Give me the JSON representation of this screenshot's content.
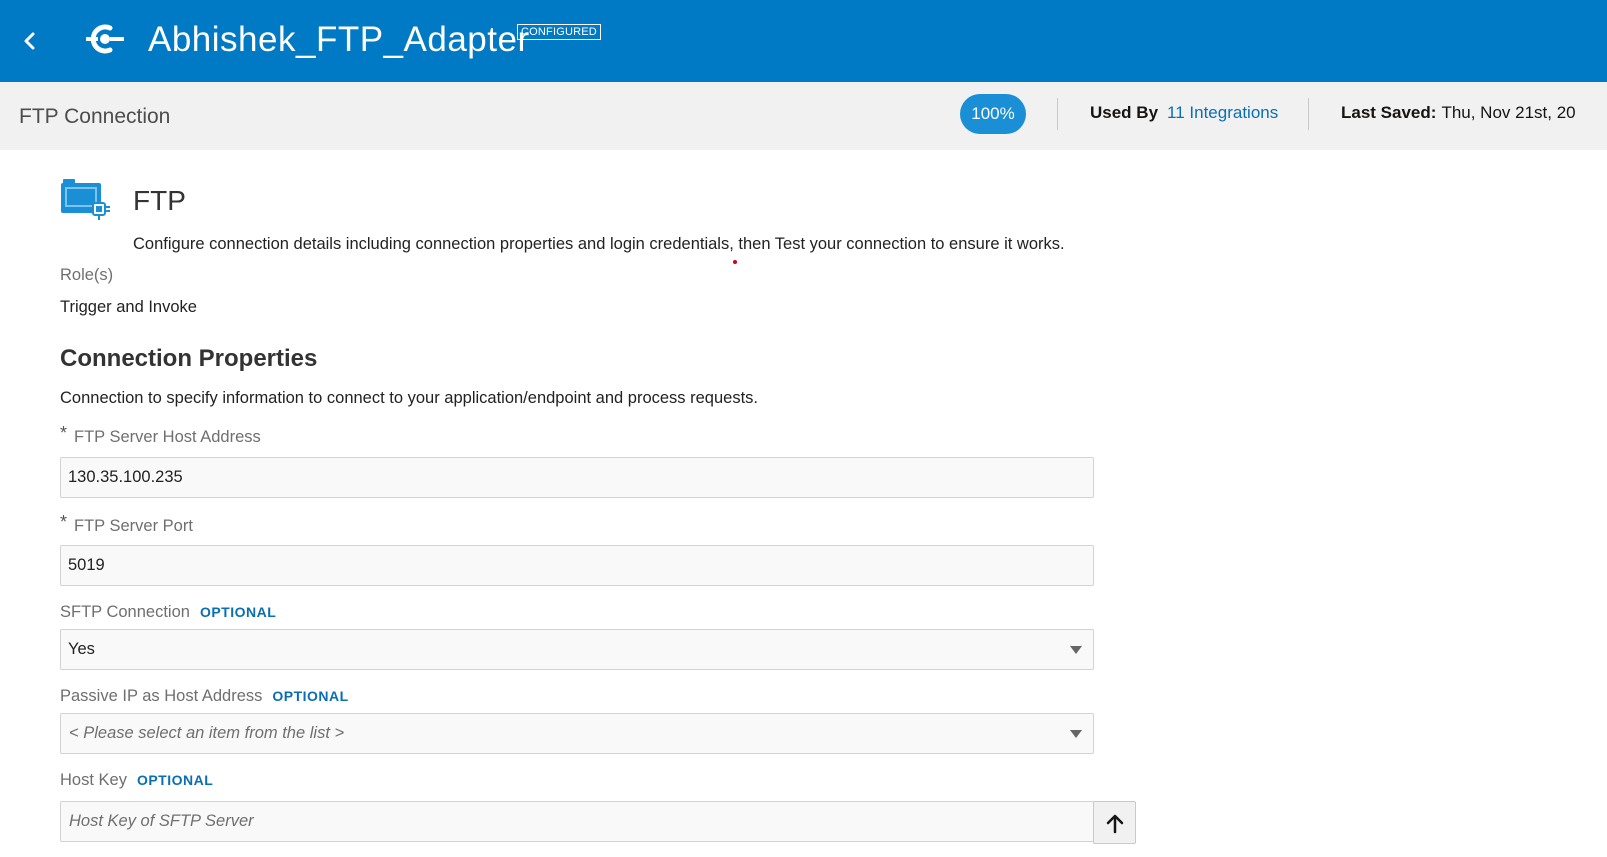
{
  "header": {
    "title": "Abhishek_FTP_Adapter",
    "status_badge": "CONFIGURED",
    "back_icon": "chevron-left-icon",
    "app_icon": "connection-plug-icon",
    "accent": "#007ac5"
  },
  "subheader": {
    "title": "FTP Connection",
    "progress_label": "100%",
    "progress_value": 1.0,
    "used_by_label": "Used By",
    "used_by_link": "11 Integrations",
    "last_saved_label": "Last Saved:",
    "last_saved_value": "Thu, Nov 21st, 20"
  },
  "adapter": {
    "icon": "ftp-adapter-icon",
    "name": "FTP",
    "description": "Configure connection details including connection properties and login credentials, then Test your connection to ensure it works.",
    "roles_label": "Role(s)",
    "roles_value": "Trigger and Invoke"
  },
  "connection_properties": {
    "title": "Connection Properties",
    "description": "Connection to specify information to connect to your application/endpoint and process requests.",
    "host": {
      "required": "*",
      "label": "FTP Server Host Address",
      "value": "130.35.100.235"
    },
    "port": {
      "required": "*",
      "label": "FTP Server Port",
      "value": "5019"
    },
    "sftp": {
      "label": "SFTP Connection",
      "optional": "OPTIONAL",
      "value": "Yes"
    },
    "passive_ip": {
      "label": "Passive IP as Host Address",
      "optional": "OPTIONAL",
      "placeholder": "< Please select an item from the list >"
    },
    "host_key": {
      "label": "Host Key",
      "optional": "OPTIONAL",
      "placeholder": "Host Key of SFTP Server",
      "upload_icon": "upload-arrow-icon"
    }
  }
}
